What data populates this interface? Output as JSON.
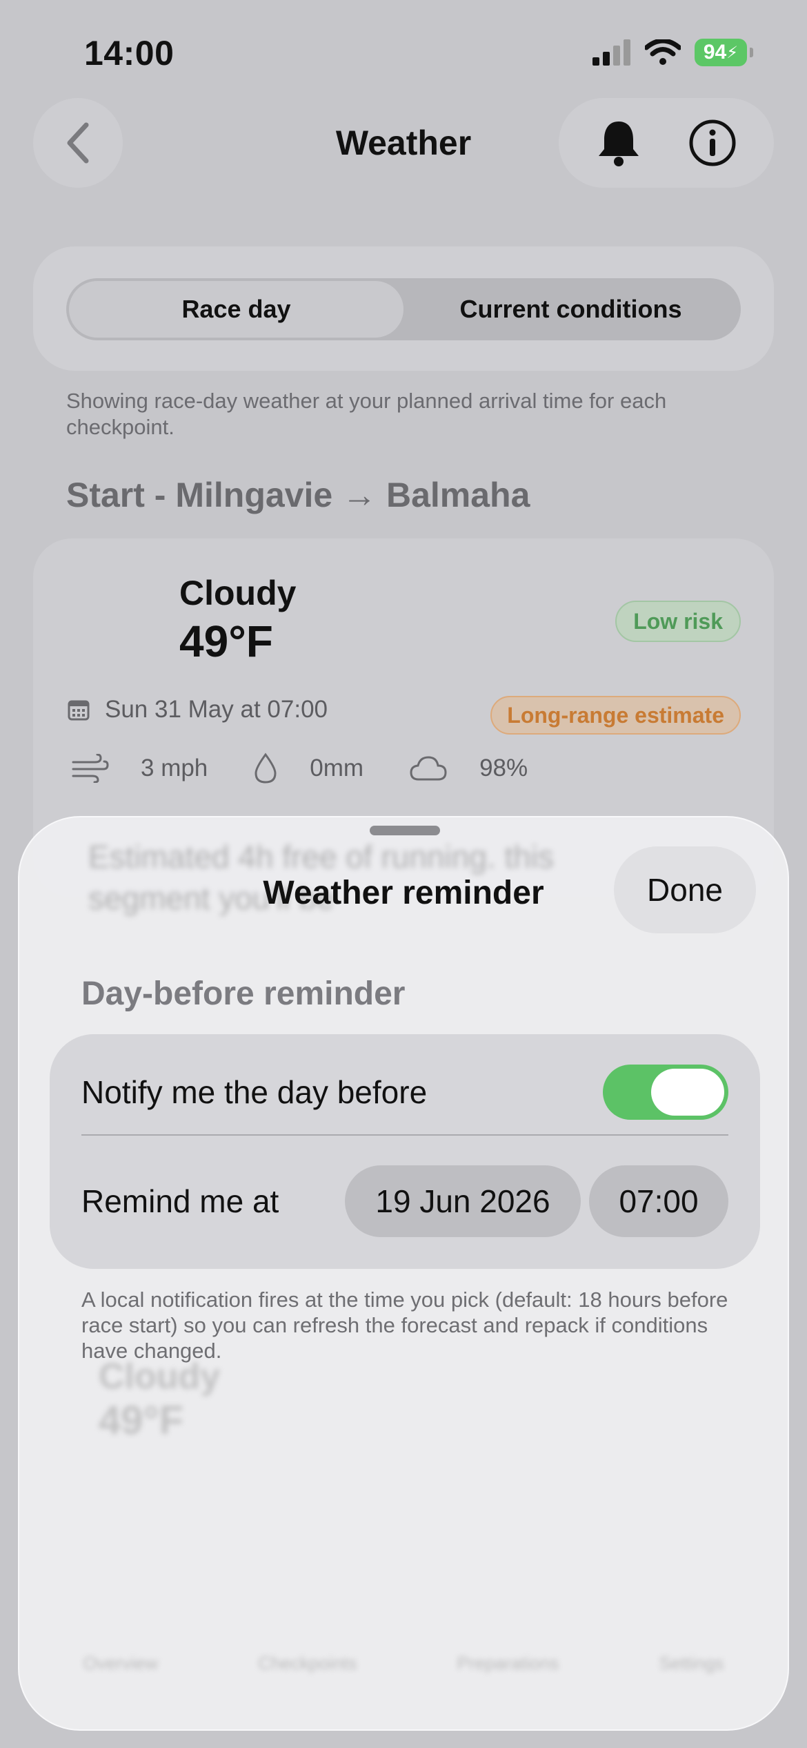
{
  "status_bar": {
    "time": "14:00",
    "battery": "94"
  },
  "nav": {
    "title": "Weather"
  },
  "segment": {
    "race_day": "Race day",
    "current": "Current conditions"
  },
  "hint": "Showing race-day weather at your planned arrival time for each checkpoint.",
  "section_title": "Start - Milngavie → Balmaha",
  "card": {
    "condition": "Cloudy",
    "temperature": "49°F",
    "risk": "Low risk",
    "date": "Sun 31 May at 07:00",
    "estimate": "Long-range estimate",
    "wind": "3 mph",
    "rain": "0mm",
    "cloud": "98%"
  },
  "background_blurred": {
    "text1": "Estimated 4h free of running. this",
    "text2": "segment you'll be",
    "card2_condition": "Cloudy",
    "card2_temp": "49°F",
    "tabs": [
      "Overview",
      "Checkpoints",
      "Preparations",
      "Settings"
    ]
  },
  "sheet": {
    "title": "Weather reminder",
    "done_label": "Done",
    "section": "Day-before reminder",
    "notify_label": "Notify me the day before",
    "notify_on": true,
    "remind_label": "Remind me at",
    "remind_date": "19 Jun 2026",
    "remind_time": "07:00",
    "footnote": "A local notification fires at the time you pick (default: 18 hours before race start) so you can refresh the forecast and repack if conditions have changed."
  },
  "colors": {
    "toggle_on": "#5cc266",
    "risk_green": "#4f9a58",
    "estimate_orange": "#c87b34"
  }
}
